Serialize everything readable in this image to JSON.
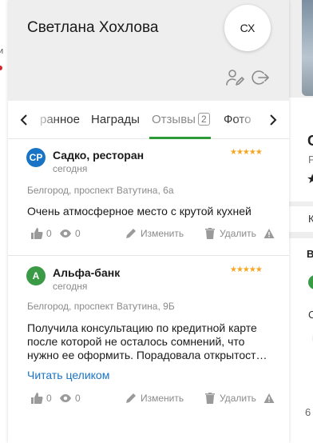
{
  "background_left": {
    "fragment": "и"
  },
  "background_right": {
    "title_fragment": "С",
    "subtitle_fragment": "Р",
    "star": "★",
    "k_fragment": "К",
    "v_fragment": "В",
    "c_fragment": "С",
    "p_fragment": "Р",
    "bottom_fragment": "6"
  },
  "header": {
    "user_name": "Светлана Хохлова",
    "avatar_initials": "СХ"
  },
  "tabs": {
    "items": [
      {
        "label": "ранное"
      },
      {
        "label": "Награды"
      },
      {
        "label": "Отзывы",
        "count": "2"
      },
      {
        "label": "Фото"
      }
    ],
    "active_color": "#2d9a3a"
  },
  "reviews": [
    {
      "avatar": "СР",
      "avatar_color": "#1a74c6",
      "name": "Садко, ресторан",
      "date": "сегодня",
      "rating": 5,
      "stars": "★★★★★",
      "address": "Белгород, проспект Ватутина, 6а",
      "text": "Очень атмосферное место с крутой кухней",
      "likes": "0",
      "views": "0",
      "edit_label": "Изменить",
      "delete_label": "Удалить"
    },
    {
      "avatar": "А",
      "avatar_color": "#3a9a46",
      "name": "Альфа-банк",
      "date": "сегодня",
      "rating": 5,
      "stars": "★★★★★",
      "address": "Белгород, проспект Ватутина, 9Б",
      "text": "Получила консультацию по кредитной карте после которой не осталось сомнений, что нужно ее оформить. Порадовала открытост…",
      "read_more": "Читать целиком",
      "likes": "0",
      "views": "0",
      "edit_label": "Изменить",
      "delete_label": "Удалить"
    }
  ]
}
